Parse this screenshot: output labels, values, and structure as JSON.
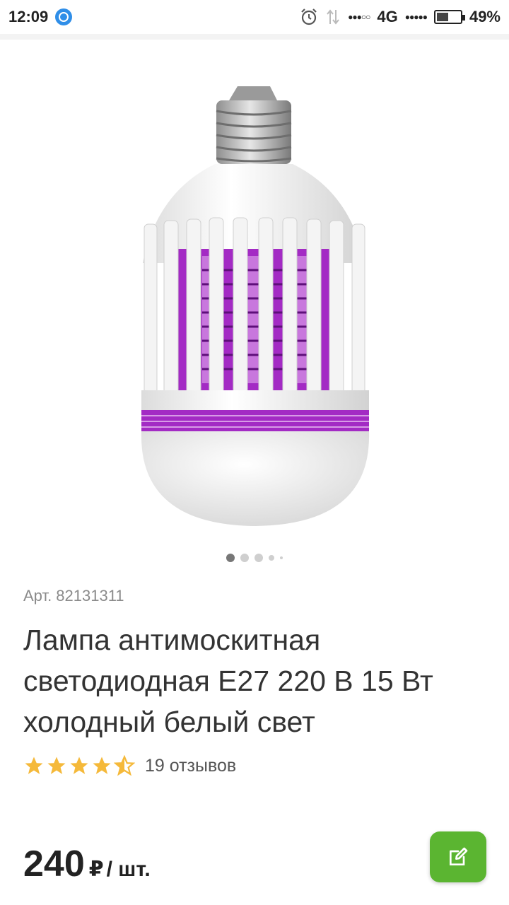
{
  "status_bar": {
    "time": "12:09",
    "network": "4G",
    "battery": "49%",
    "battery_level": 0.49,
    "icons": [
      "alarm-icon",
      "data-transfer-icon",
      "signal-icon",
      "battery-icon"
    ]
  },
  "product": {
    "article": "Арт. 82131311",
    "title": "Лампа антимоскитная светодиодная E27 220 В 15 Вт холодный белый свет",
    "rating": 4.5,
    "rating_max": 5,
    "reviews": "19 отзывов",
    "price": "240",
    "currency": "₽",
    "unit": "/ шт."
  },
  "carousel": {
    "count": 5,
    "active": 0
  },
  "colors": {
    "accent_green": "#5bb531",
    "star": "#f5b93a",
    "lamp_purple": "#a32bc4",
    "text": "#333333",
    "muted": "#8a8a8a"
  },
  "fab": {
    "icon": "edit-icon"
  }
}
